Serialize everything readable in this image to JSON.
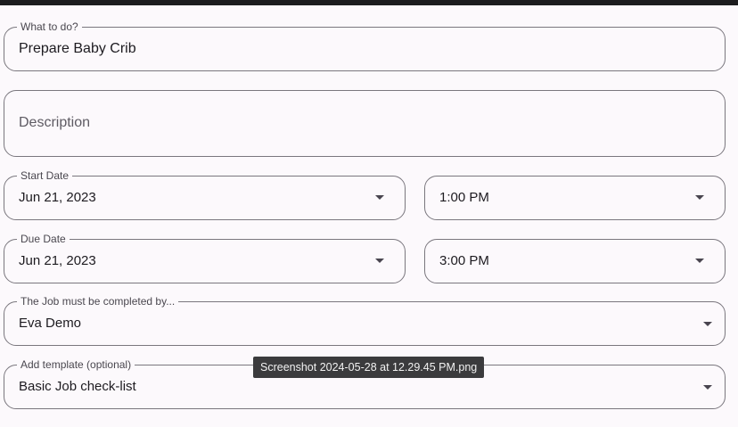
{
  "form": {
    "title_field": {
      "label": "What to do?",
      "value": "Prepare Baby Crib"
    },
    "description_field": {
      "placeholder": "Description"
    },
    "start": {
      "label": "Start Date",
      "date": "Jun 21, 2023",
      "time": "1:00 PM"
    },
    "due": {
      "label": "Due Date",
      "date": "Jun 21, 2023",
      "time": "3:00 PM"
    },
    "assignee": {
      "label": "The Job must be completed by...",
      "value": "Eva Demo"
    },
    "template": {
      "label": "Add template (optional)",
      "value": "Basic Job check-list"
    }
  },
  "tooltip": {
    "text": "Screenshot 2024-05-28 at 12.29.45 PM.png"
  },
  "icons": {
    "dropdown": "arrow-drop-down-icon"
  },
  "colors": {
    "background": "#fcf9fc",
    "outline": "#7a777e",
    "text": "#1d1b20",
    "tooltip_bg": "#3b3b3d"
  }
}
